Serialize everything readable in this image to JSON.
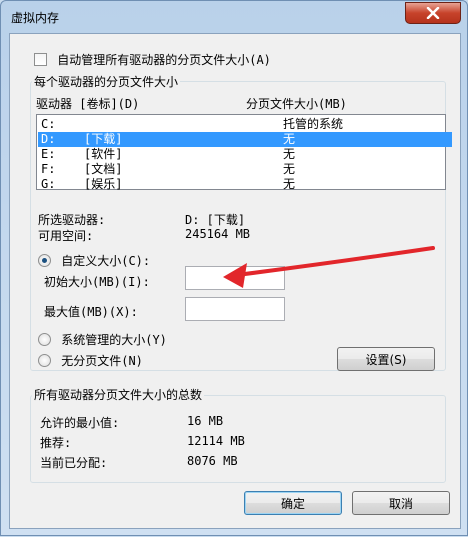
{
  "window": {
    "title": "虚拟内存"
  },
  "auto_manage": {
    "label": "自动管理所有驱动器的分页文件大小(A)",
    "checked": false
  },
  "per_drive_group": {
    "legend": "每个驱动器的分页文件大小",
    "col_drive": "驱动器 [卷标](D)",
    "col_size": "分页文件大小(MB)",
    "drives": [
      {
        "letter": "C:",
        "label": "",
        "size": "托管的系统",
        "selected": false
      },
      {
        "letter": "D:",
        "label": "[下载]",
        "size": "无",
        "selected": true
      },
      {
        "letter": "E:",
        "label": "[软件]",
        "size": "无",
        "selected": false
      },
      {
        "letter": "F:",
        "label": "[文档]",
        "size": "无",
        "selected": false
      },
      {
        "letter": "G:",
        "label": "[娱乐]",
        "size": "无",
        "selected": false
      }
    ],
    "selected_drive_label": "所选驱动器:",
    "selected_drive_value": "D:  [下载]",
    "free_space_label": "可用空间:",
    "free_space_value": "245164 MB",
    "custom_size_label": "自定义大小(C):",
    "initial_size_label": "初始大小(MB)(I):",
    "initial_size_value": "",
    "max_size_label": "最大值(MB)(X):",
    "max_size_value": "",
    "system_managed_label": "系统管理的大小(Y)",
    "no_paging_label": "无分页文件(N)",
    "set_button": "设置(S)"
  },
  "total_group": {
    "legend": "所有驱动器分页文件大小的总数",
    "min_label": "允许的最小值:",
    "min_value": "16 MB",
    "recommended_label": "推荐:",
    "recommended_value": "12114 MB",
    "allocated_label": "当前已分配:",
    "allocated_value": "8076 MB"
  },
  "footer": {
    "ok_button": "确定",
    "cancel_button": "取消"
  },
  "annotation": {
    "arrow_color": "#e2262b"
  }
}
